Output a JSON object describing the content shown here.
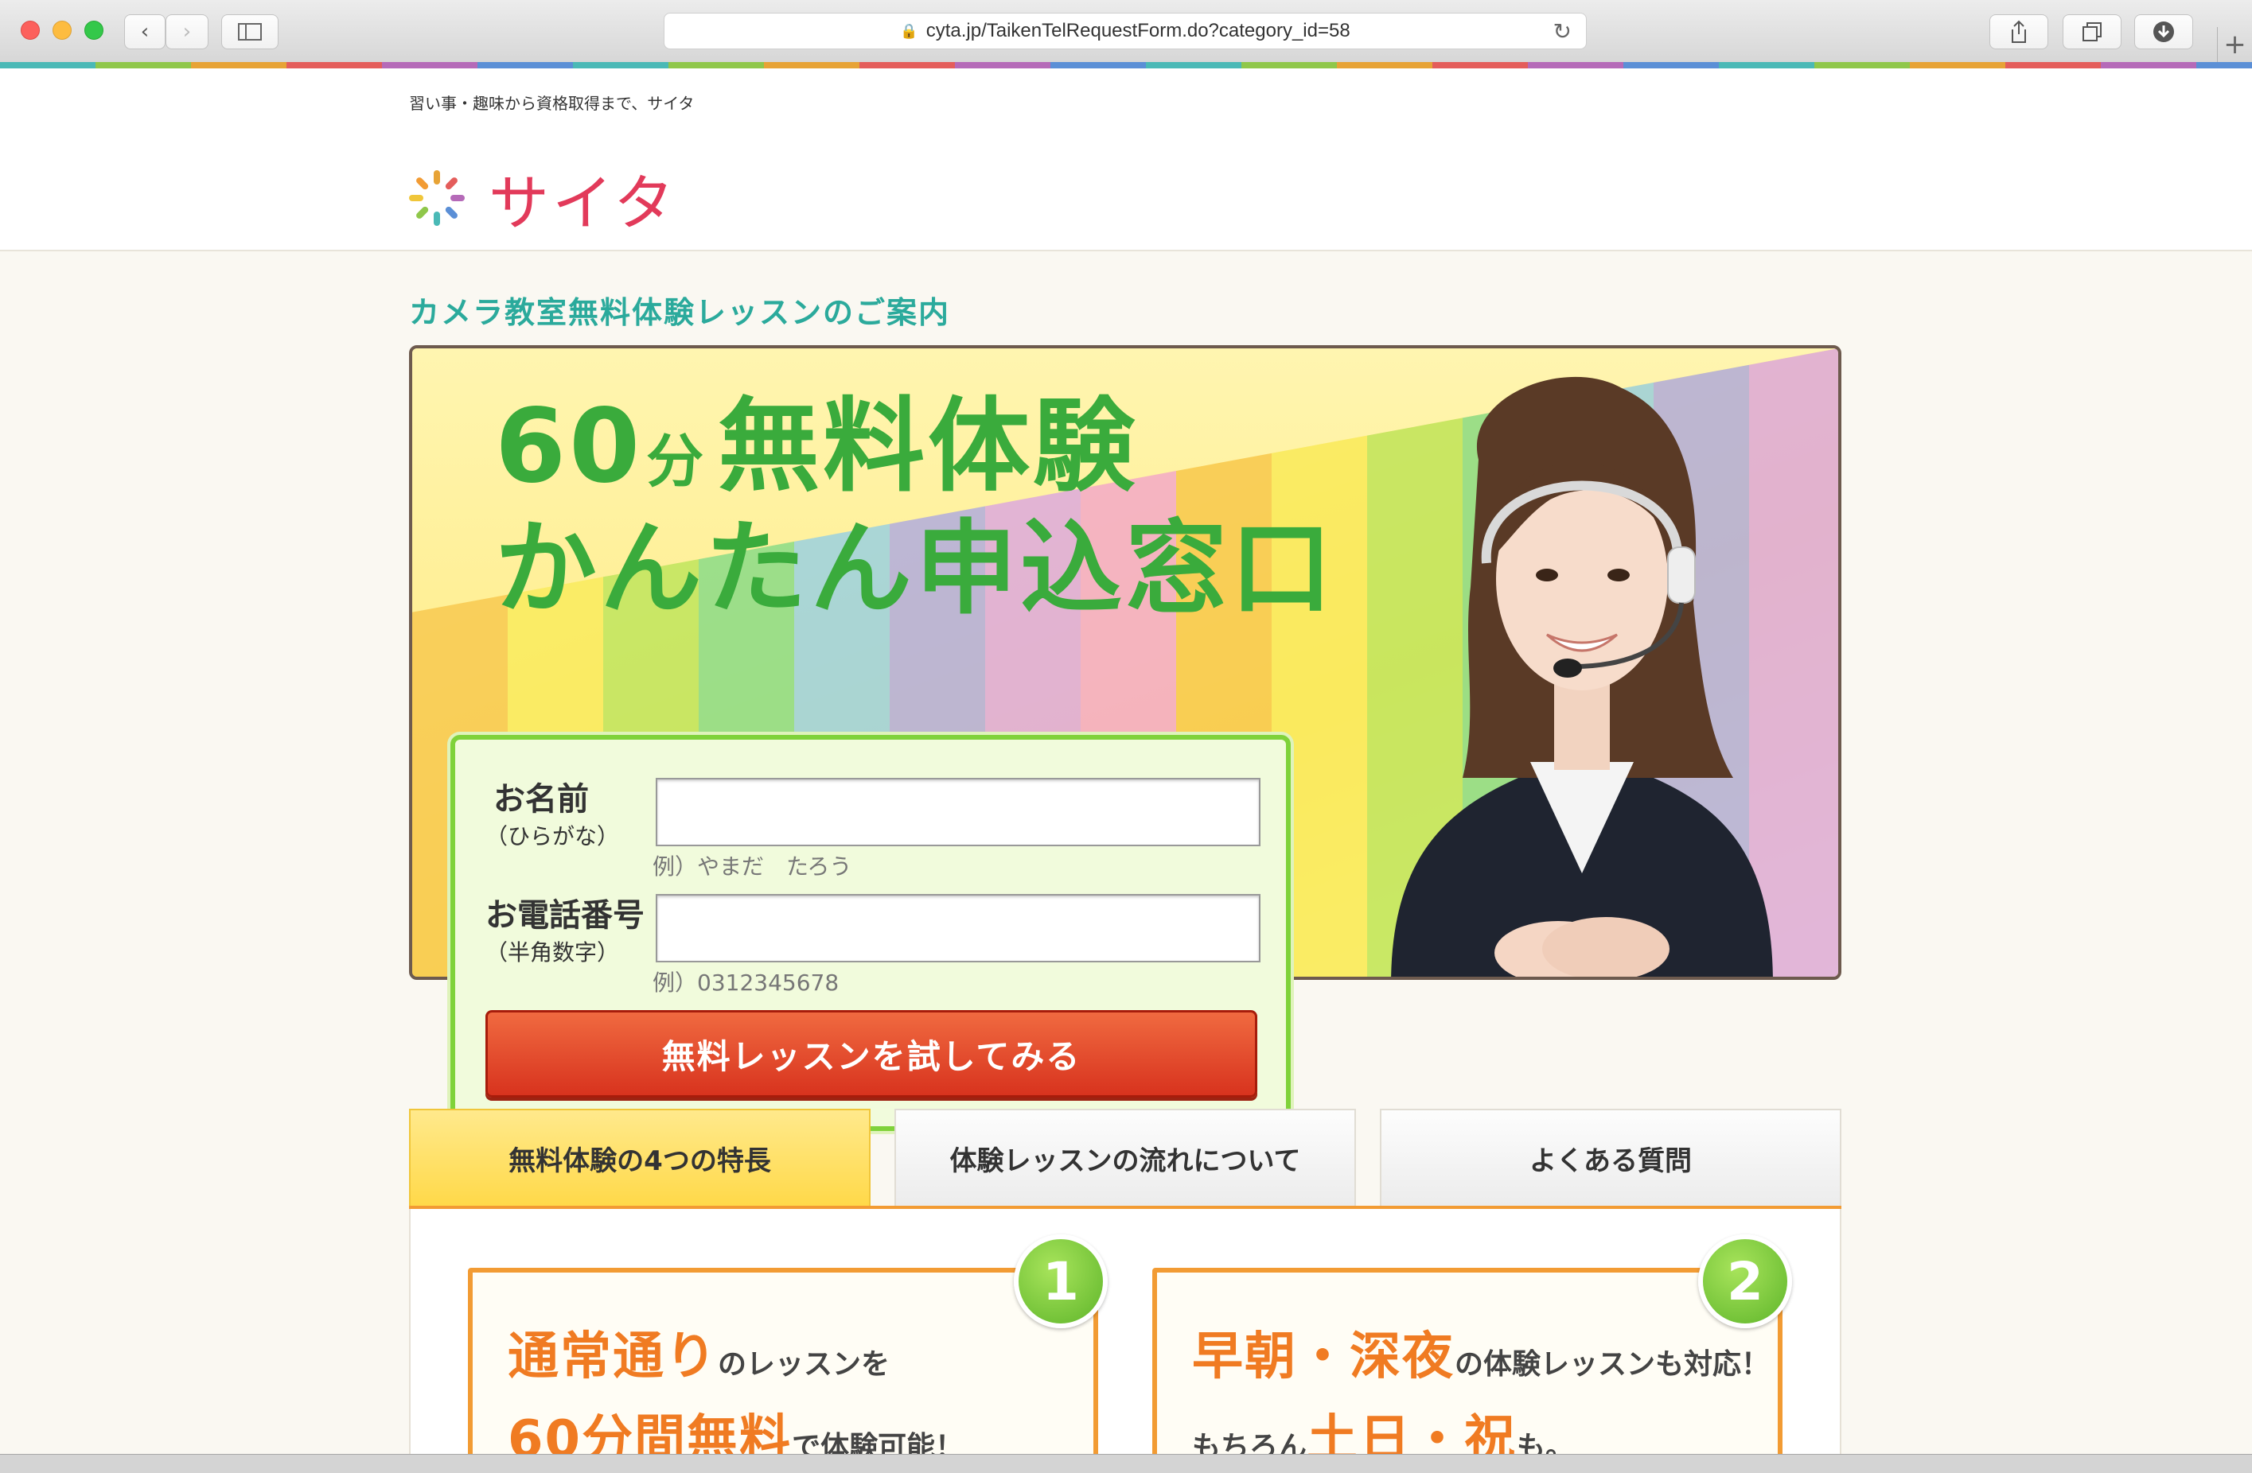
{
  "browser": {
    "url": "cyta.jp/TaikenTelRequestForm.do?category_id=58"
  },
  "header": {
    "tagline": "習い事・趣味から資格取得まで、サイタ",
    "logo_text": "サイタ"
  },
  "page_title": "カメラ教室無料体験レッスンのご案内",
  "hero": {
    "headline_number": "60",
    "headline_unit": "分",
    "headline_rest": "無料体験",
    "headline_line2": "かんたん申込窓口"
  },
  "form": {
    "name_label": "お名前",
    "name_sub": "（ひらがな）",
    "name_value": "",
    "name_hint": "例）やまだ　たろう",
    "phone_label": "お電話番号",
    "phone_sub": "（半角数字）",
    "phone_value": "",
    "phone_hint": "例）0312345678",
    "submit_label": "無料レッスンを試してみる"
  },
  "tabs": [
    {
      "label": "無料体験の4つの特長"
    },
    {
      "label": "体験レッスンの流れについて"
    },
    {
      "label": "よくある質問"
    }
  ],
  "features": [
    {
      "number": "1",
      "line1_big": "通常通り",
      "line1_small": "のレッスンを",
      "line2_big": "60分間無料",
      "line2_small": "で体験可能！"
    },
    {
      "number": "2",
      "line1_big": "早朝・深夜",
      "line1_small": "の体験レッスンも対応！",
      "line2_prefix": "もちろん",
      "line2_big": "土日・祝",
      "line2_small": "も。"
    }
  ],
  "colors": {
    "accent_teal": "#2baa9c",
    "headline_green": "#3aab3c",
    "logo_pink": "#e23a5a",
    "cta_red": "#d8331e",
    "feature_orange": "#f07b22"
  }
}
